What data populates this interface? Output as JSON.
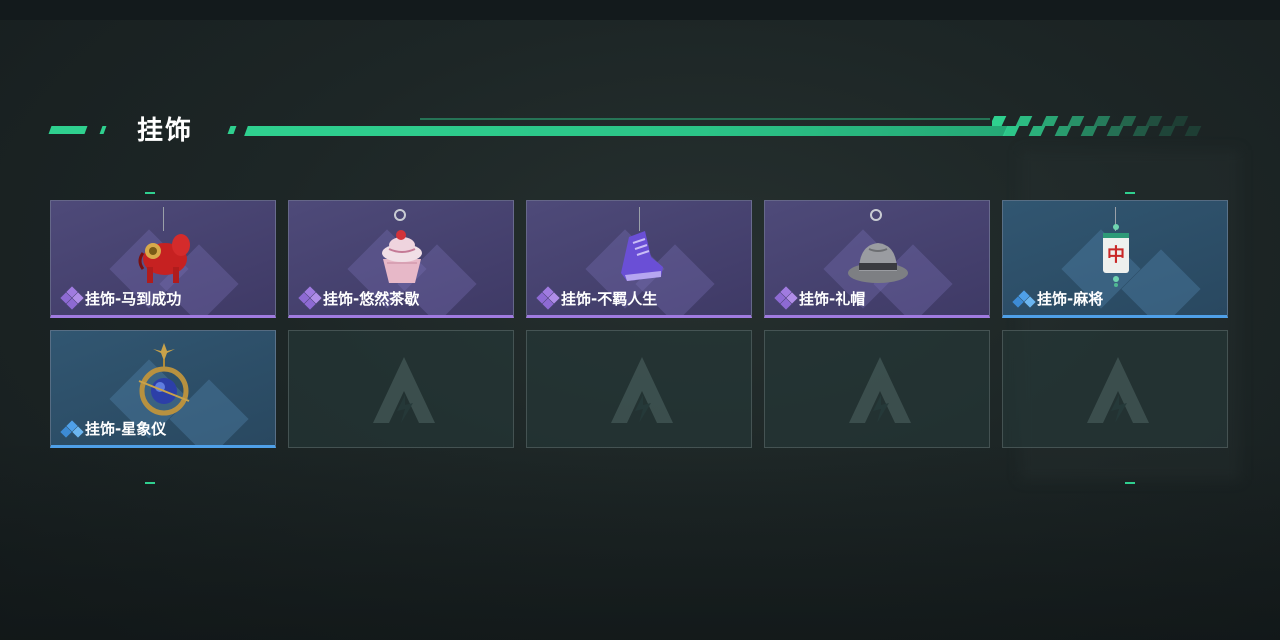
{
  "section": {
    "title": "挂饰"
  },
  "colors": {
    "accent": "#2fd08f",
    "rarity_purple": "#a07be0",
    "rarity_blue": "#4fa0e8"
  },
  "items": [
    {
      "label": "挂饰-马到成功",
      "rarity": "purple",
      "icon": "red-horse-charm-icon"
    },
    {
      "label": "挂饰-悠然茶歇",
      "rarity": "purple",
      "icon": "cupcake-charm-icon"
    },
    {
      "label": "挂饰-不羁人生",
      "rarity": "purple",
      "icon": "sneaker-charm-icon"
    },
    {
      "label": "挂饰-礼帽",
      "rarity": "purple",
      "icon": "fedora-hat-charm-icon"
    },
    {
      "label": "挂饰-麻将",
      "rarity": "blue",
      "icon": "mahjong-tile-charm-icon"
    },
    {
      "label": "挂饰-星象仪",
      "rarity": "blue",
      "icon": "astrolabe-charm-icon"
    }
  ],
  "empty_slot_icon": "game-logo-placeholder-icon"
}
